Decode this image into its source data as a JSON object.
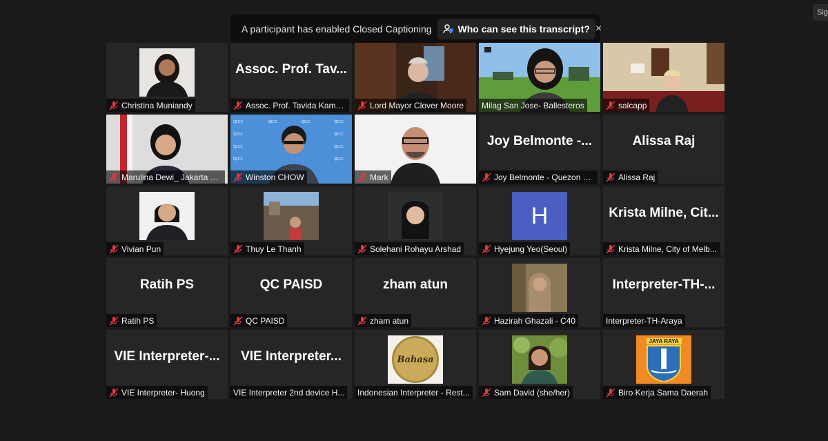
{
  "banner": {
    "message": "A participant has enabled Closed Captioning",
    "transcript_button": "Who can see this transcript?",
    "close_glyph": "×"
  },
  "corner": {
    "label": "Sig"
  },
  "participants": [
    {
      "label": "Christina Muniandy",
      "muted": true
    },
    {
      "label": "Assoc. Prof. Tavida Kamol...",
      "big": "Assoc. Prof. Tav...",
      "muted": true
    },
    {
      "label": "Lord Mayor Clover Moore",
      "muted": true
    },
    {
      "label": "Milag San Jose- Ballesteros",
      "muted": false,
      "active": true
    },
    {
      "label": "salcapp",
      "muted": true
    },
    {
      "label": "Marulina Dewi_ Jakarta C...",
      "muted": true
    },
    {
      "label": "Winston CHOW",
      "muted": true
    },
    {
      "label": "Mark",
      "muted": true
    },
    {
      "label": "Joy Belmonte - Quezon C...",
      "big": "Joy Belmonte -...",
      "muted": true
    },
    {
      "label": "Alissa Raj",
      "big": "Alissa Raj",
      "muted": true
    },
    {
      "label": "Vivian Pun",
      "muted": true
    },
    {
      "label": "Thuy Le Thanh",
      "muted": true
    },
    {
      "label": "Solehani Rohayu Arshad",
      "muted": true
    },
    {
      "label": "Hyejung Yeo(Seoul)",
      "avatar_letter": "H",
      "muted": true
    },
    {
      "label": "Krista Milne, City of Melb...",
      "big": "Krista Milne, Cit...",
      "muted": true
    },
    {
      "label": "Ratih PS",
      "big": "Ratih PS",
      "muted": true
    },
    {
      "label": "QC PAISD",
      "big": "QC PAISD",
      "muted": true
    },
    {
      "label": "zham atun",
      "big": "zham atun",
      "muted": true
    },
    {
      "label": "Hazirah Ghazali - C40",
      "muted": true
    },
    {
      "label": "Interpreter-TH-Araya",
      "big": "Interpreter-TH-...",
      "muted": false
    },
    {
      "label": "VIE Interpreter- Huong",
      "big": "VIE Interpreter-...",
      "muted": true
    },
    {
      "label": "VIE Interpreter 2nd device H...",
      "big": "VIE Interpreter...",
      "muted": false
    },
    {
      "label": "Indonesian Interpreter - Rest...",
      "logo_text": "Bahasa",
      "muted": false
    },
    {
      "label": "Sam David (she/her)",
      "muted": true
    },
    {
      "label": "Biro Kerja Sama Daerah",
      "logo_text": "JAYA RAYA",
      "muted": true
    }
  ],
  "colors": {
    "background": "#1a1a1a",
    "tile": "#262626",
    "active_speaker": "#c9e550",
    "muted_icon": "#e0393e",
    "avatar_blue": "#4a5fc1"
  }
}
